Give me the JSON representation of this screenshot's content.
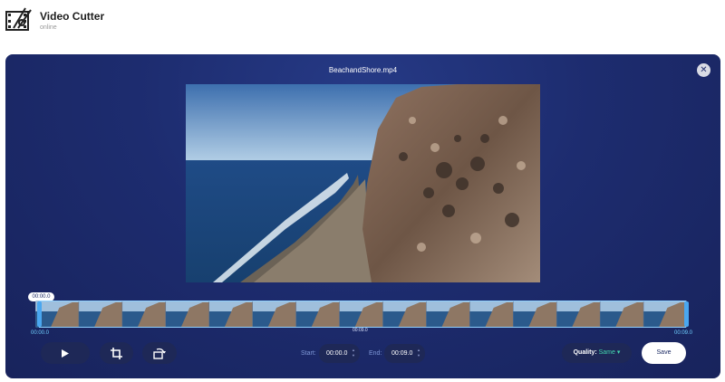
{
  "app": {
    "title": "Video Cutter",
    "subtitle": "online",
    "logo_icon": "film-scissors-icon"
  },
  "editor": {
    "file_name": "BeachandShore.mp4",
    "close_icon": "close-icon",
    "video_description_icon": "video-preview",
    "timeline": {
      "current_time": "00:00.0",
      "start_time": "00:00.0",
      "mid_time": "00:09.0",
      "end_time": "00:09.0",
      "thumbnail_count": 15
    },
    "controls": {
      "play_icon": "play-icon",
      "crop_icon": "crop-icon",
      "rotate_icon": "rotate-icon",
      "start_label": "Start:",
      "start_value": "00:00.0",
      "end_label": "End:",
      "end_value": "00:09.0",
      "quality_label": "Quality:",
      "quality_value": "Same",
      "save_label": "Save"
    }
  },
  "colors": {
    "panel": "#1d2c6f",
    "accent": "#4aa7f0",
    "quality_value": "#43d6ad"
  }
}
